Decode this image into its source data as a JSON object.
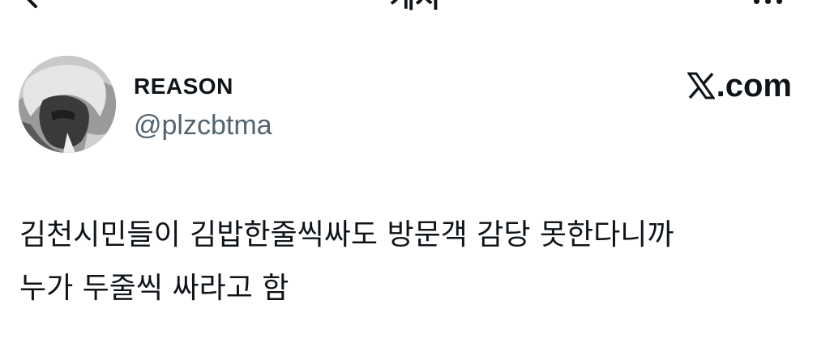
{
  "header": {
    "back_icon": "chevron-left-icon",
    "title": "게시",
    "more_icon": "ellipsis-icon"
  },
  "author": {
    "display_name": "REASON",
    "handle": "@plzcbtma",
    "avatar": "profile-avatar"
  },
  "source": {
    "icon": "x-logo-icon",
    "label": ".com"
  },
  "tweet": {
    "lines": [
      "김천시민들이 김밥한줄씩싸도 방문객 감당 못한다니까",
      "누가 두줄씩 싸라고 함"
    ]
  }
}
